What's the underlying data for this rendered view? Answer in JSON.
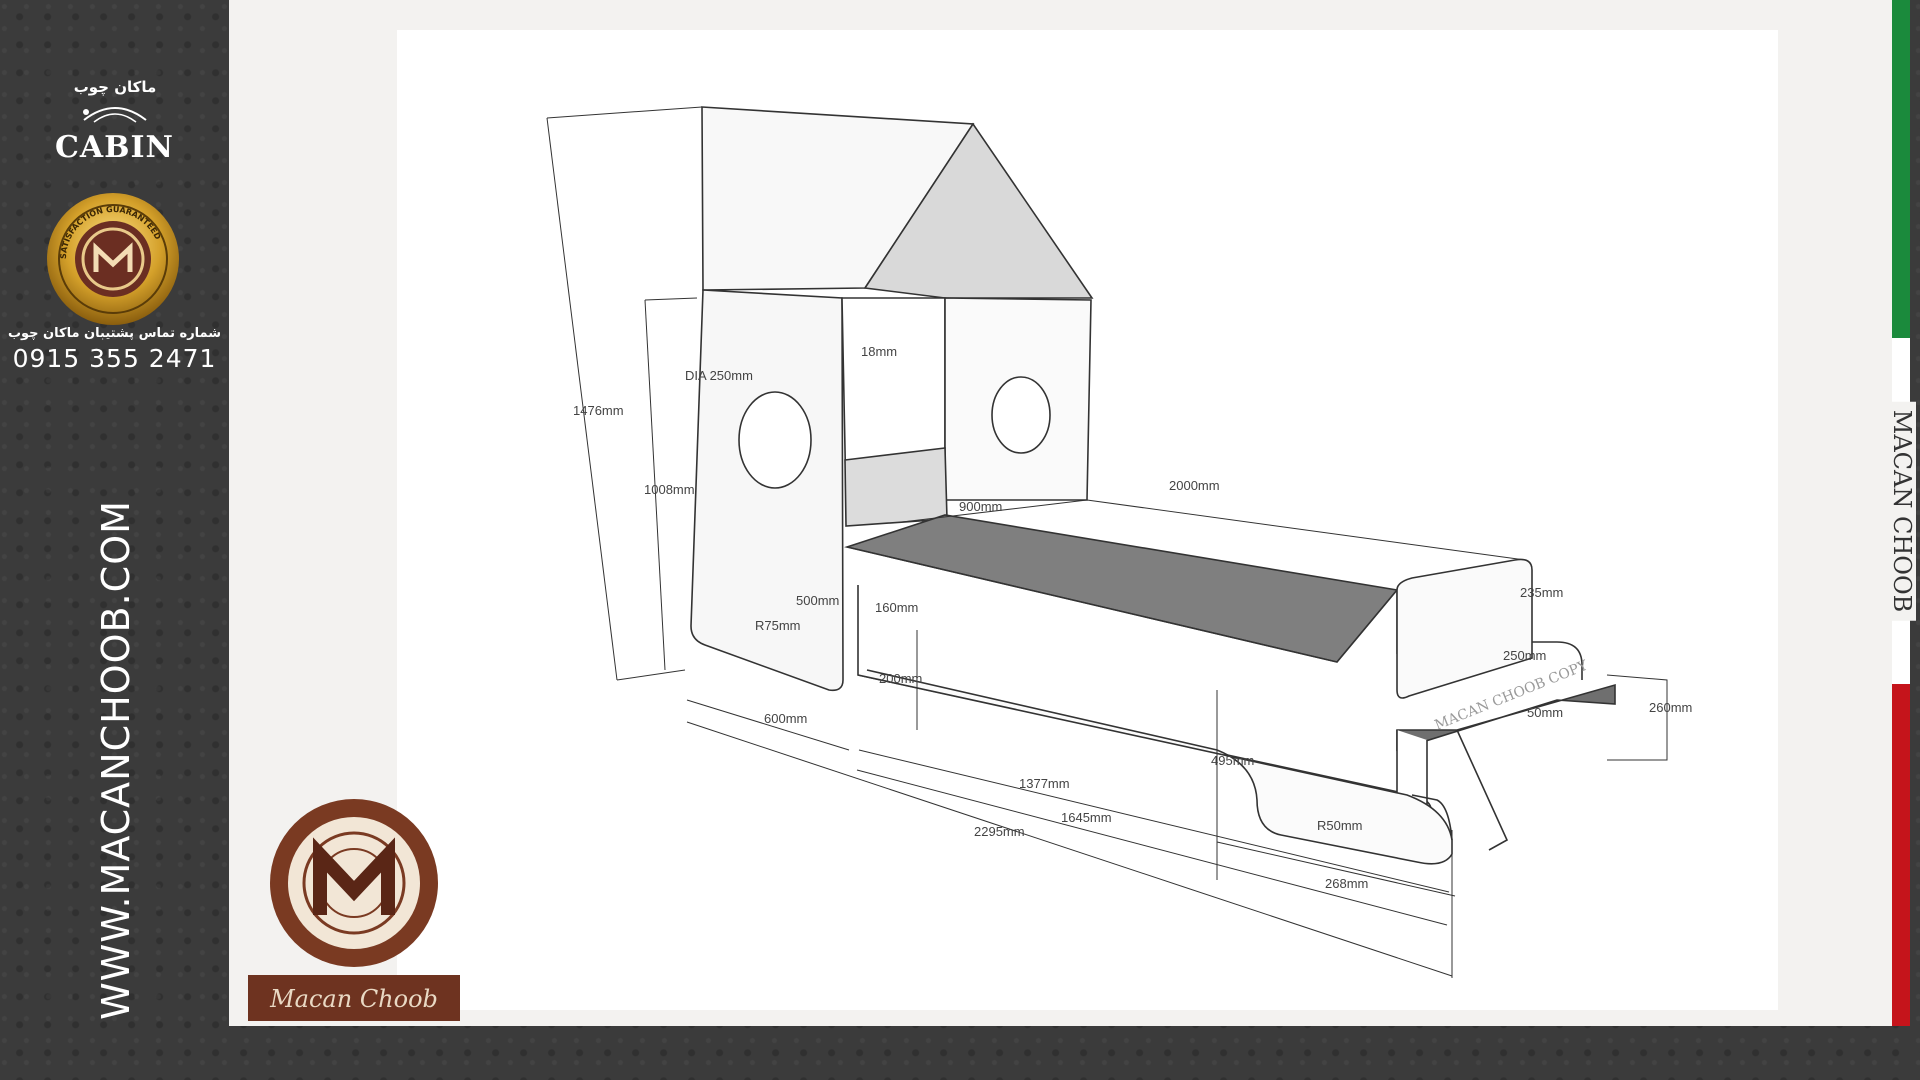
{
  "sidebar": {
    "brand_logo_text": "ماکان چوب",
    "brand_name": "CABIN",
    "seal_text": "SATISFACTION GUARANTEED",
    "support_label": "شماره تماس پشتیبان ماکان چوب",
    "support_phone": "0915 355 2471",
    "website": "WWW.MACANCHOOB.COM"
  },
  "corner_logo": {
    "text": "Macan Choob"
  },
  "vertical_brand": "MACAN CHOOB",
  "watermark": "MACAN CHOOB COPY",
  "dimensions": {
    "height_total": "1476mm",
    "height_headboard": "1008mm",
    "window_dia": "DIA 250mm",
    "panel_thickness": "18mm",
    "bed_width": "900mm",
    "bed_length": "2000mm",
    "foot_height": "235mm",
    "side_rail": "500mm",
    "slat_gap": "160mm",
    "radius_head": "R75mm",
    "floor_clear": "200mm",
    "head_depth": "600mm",
    "frame_len": "1377mm",
    "side_len": "1645mm",
    "total_len": "2295mm",
    "step_depth": "250mm",
    "step_width": "50mm",
    "step_height": "260mm",
    "foot_panel_h": "495mm",
    "radius_foot": "R50mm",
    "foot_base": "268mm"
  }
}
